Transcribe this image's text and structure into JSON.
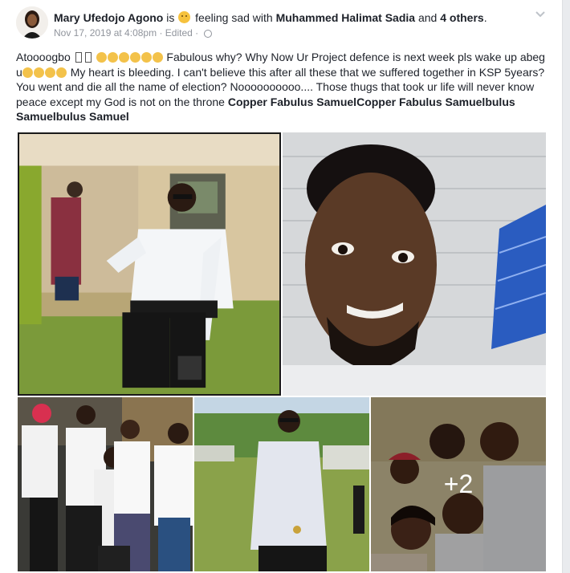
{
  "post": {
    "author": "Mary Ufedojo Agono",
    "is_text": "is",
    "feeling_text": "feeling sad with",
    "tagged_person": "Muhammed Halimat Sadia",
    "and_text": "and",
    "others_text": "4 others",
    "period": ".",
    "timestamp": "Nov 17, 2019 at 4:08pm",
    "edited": "· Edited ·",
    "body": {
      "p1": "Atoooogbo",
      "p2": "Fabulous why? Why Now Ur Project defence is next week pls wake up abeg u",
      "p3": "My heart is bleeding. I can't believe this after all these that we suffered together in KSP 5years? You went and die all the name of election? Noooooooooo.... Those thugs that took ur life will never know peace except my God is not on the throne",
      "tag1": "Copper Fabulus Samuel",
      "tag2": "Copper Fabulus Samuel",
      "tail": "bulus Samuelbulus Samuel"
    },
    "photos": {
      "more_count": "+2"
    }
  },
  "icons": {
    "feeling": "sad-face-emoji",
    "audience": "globe-icon",
    "menu": "chevron-down-icon"
  },
  "colors": {
    "link": "#1d2129",
    "meta": "#90949c",
    "background": "#e9ebee"
  }
}
